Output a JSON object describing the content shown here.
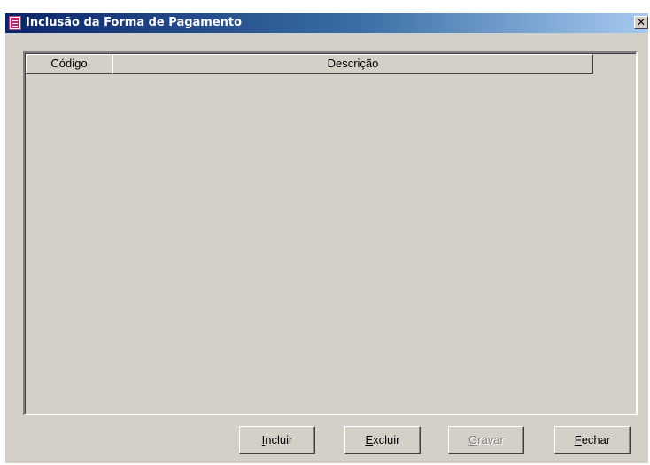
{
  "window": {
    "title": "Inclusão da Forma de Pagamento",
    "close_glyph": "✕"
  },
  "grid": {
    "columns": [
      "Código",
      "Descrição"
    ],
    "rows": []
  },
  "buttons": {
    "incluir": {
      "mnemonic": "I",
      "rest": "ncluir",
      "enabled": true
    },
    "excluir": {
      "mnemonic": "E",
      "rest": "xcluir",
      "enabled": true
    },
    "gravar": {
      "mnemonic": "G",
      "rest": "ravar",
      "enabled": false
    },
    "fechar": {
      "mnemonic": "F",
      "rest": "echar",
      "enabled": true
    }
  },
  "icons": {
    "title_icon": "document-icon",
    "close_icon": "close-icon"
  }
}
